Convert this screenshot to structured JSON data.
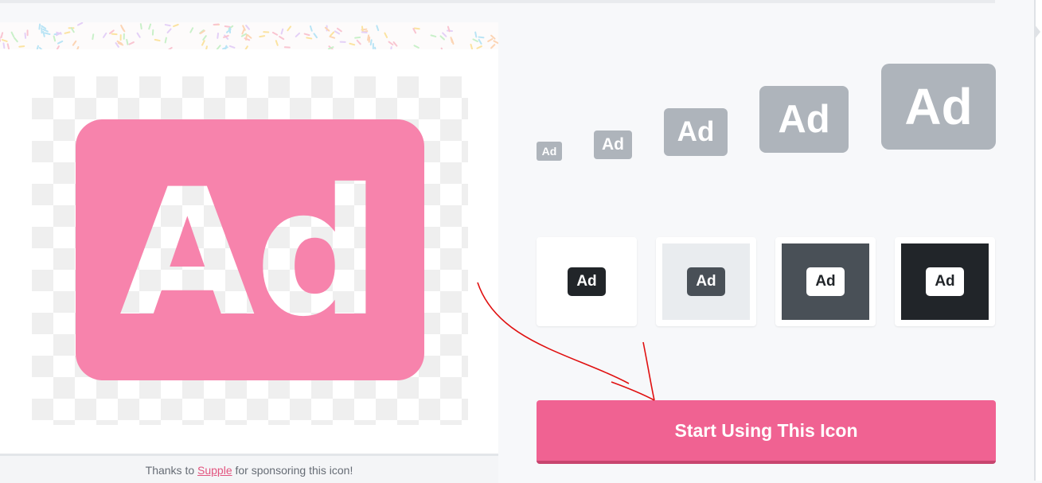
{
  "preview": {
    "icon_text": "Ad",
    "icon_color": "#f783ac",
    "footer": {
      "prefix": "Thanks to",
      "sponsor": "Supple",
      "suffix": "for sponsoring this icon!"
    }
  },
  "sizes": [
    {
      "label": "Ad"
    },
    {
      "label": "Ad"
    },
    {
      "label": "Ad"
    },
    {
      "label": "Ad"
    },
    {
      "label": "Ad"
    }
  ],
  "backgrounds": [
    {
      "label": "Ad",
      "bg": "#ffffff",
      "icon_bg": "#212529",
      "icon_fg": "#ffffff"
    },
    {
      "label": "Ad",
      "bg": "#e9ecef",
      "icon_bg": "#495057",
      "icon_fg": "#ffffff"
    },
    {
      "label": "Ad",
      "bg": "#495057",
      "icon_bg": "#ffffff",
      "icon_fg": "#212529"
    },
    {
      "label": "Ad",
      "bg": "#212529",
      "icon_bg": "#ffffff",
      "icon_fg": "#212529"
    }
  ],
  "cta": {
    "label": "Start Using This Icon",
    "color": "#f06292"
  },
  "colors": {
    "size_icon": "#aeb4bb",
    "annotation": "#e01010"
  }
}
